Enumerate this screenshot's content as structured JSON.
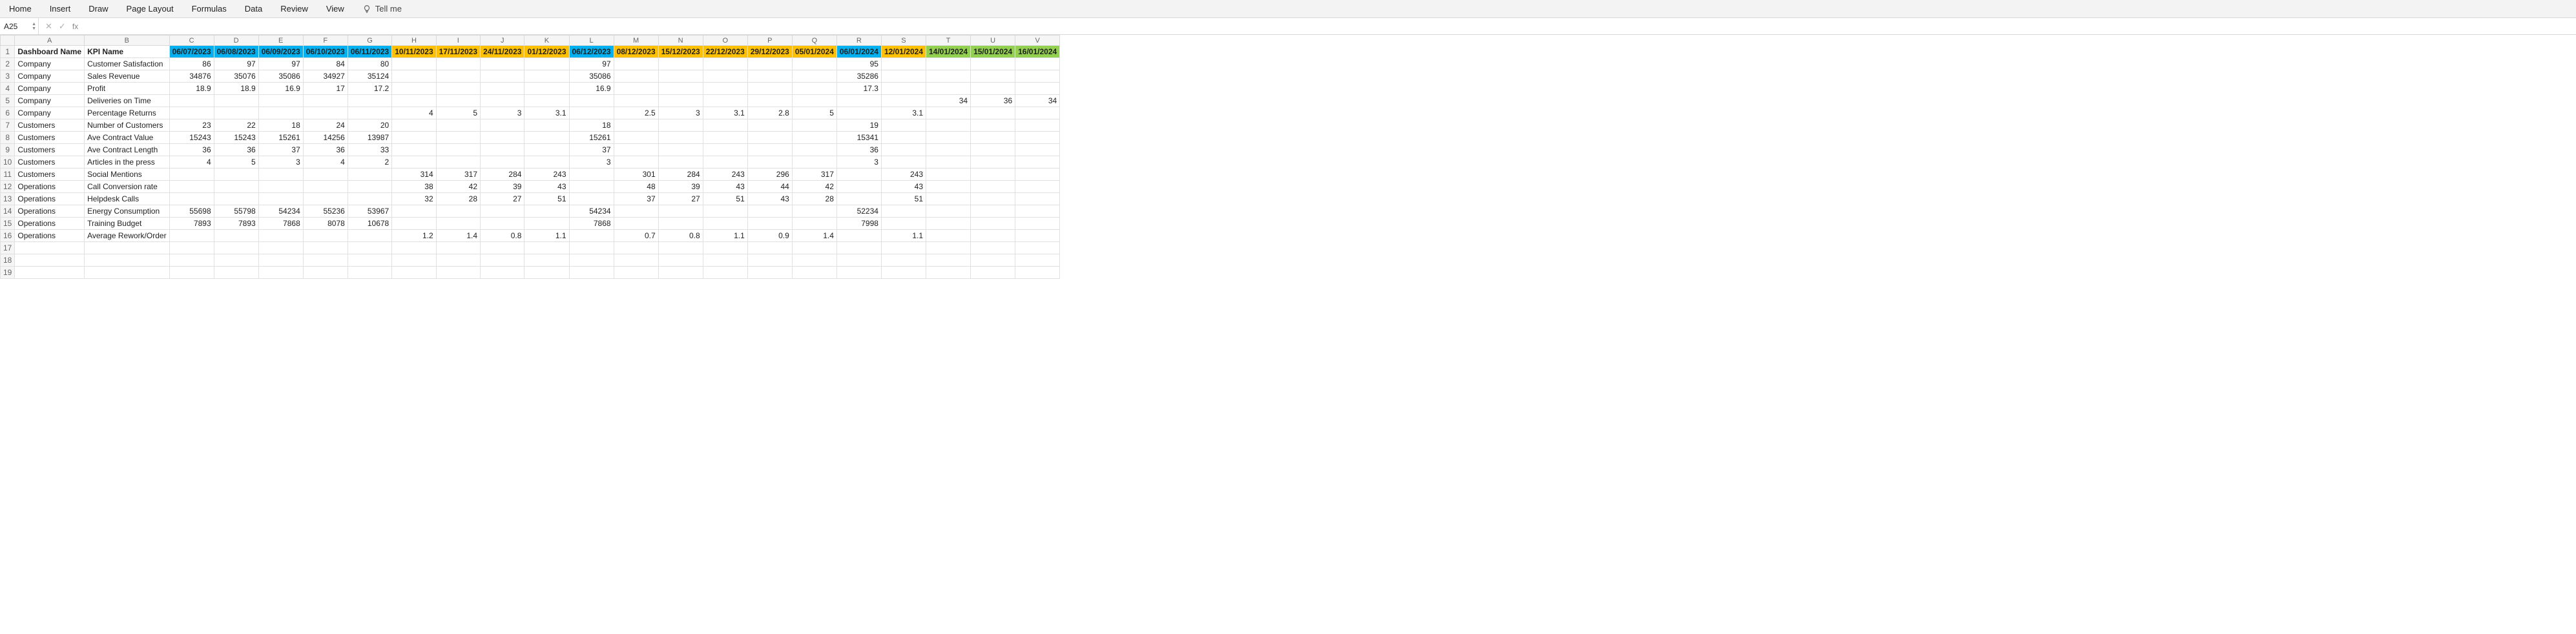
{
  "ribbon": {
    "tabs": [
      "Home",
      "Insert",
      "Draw",
      "Page Layout",
      "Formulas",
      "Data",
      "Review",
      "View"
    ],
    "tellme": "Tell me"
  },
  "fx": {
    "namebox": "A25",
    "cancel_glyph": "✕",
    "confirm_glyph": "✓",
    "fx_label": "fx",
    "formula": ""
  },
  "col_letters": [
    "A",
    "B",
    "C",
    "D",
    "E",
    "F",
    "G",
    "H",
    "I",
    "J",
    "K",
    "L",
    "M",
    "N",
    "O",
    "P",
    "Q",
    "R",
    "S",
    "T",
    "U",
    "V"
  ],
  "headers": {
    "A": "Dashboard Name",
    "B": "KPI Name",
    "dates": [
      {
        "label": "06/07/2023",
        "cls": "c-blue"
      },
      {
        "label": "06/08/2023",
        "cls": "c-blue"
      },
      {
        "label": "06/09/2023",
        "cls": "c-blue"
      },
      {
        "label": "06/10/2023",
        "cls": "c-blue"
      },
      {
        "label": "06/11/2023",
        "cls": "c-blue"
      },
      {
        "label": "10/11/2023",
        "cls": "c-orange"
      },
      {
        "label": "17/11/2023",
        "cls": "c-orange"
      },
      {
        "label": "24/11/2023",
        "cls": "c-orange"
      },
      {
        "label": "01/12/2023",
        "cls": "c-orange"
      },
      {
        "label": "06/12/2023",
        "cls": "c-blue"
      },
      {
        "label": "08/12/2023",
        "cls": "c-orange"
      },
      {
        "label": "15/12/2023",
        "cls": "c-orange"
      },
      {
        "label": "22/12/2023",
        "cls": "c-orange"
      },
      {
        "label": "29/12/2023",
        "cls": "c-orange"
      },
      {
        "label": "05/01/2024",
        "cls": "c-orange"
      },
      {
        "label": "06/01/2024",
        "cls": "c-blue"
      },
      {
        "label": "12/01/2024",
        "cls": "c-orange"
      },
      {
        "label": "14/01/2024",
        "cls": "c-green"
      },
      {
        "label": "15/01/2024",
        "cls": "c-green"
      },
      {
        "label": "16/01/2024",
        "cls": "c-green"
      }
    ]
  },
  "rows": [
    {
      "dash": "Company",
      "kpi": "Customer Satisfaction",
      "v": [
        "86",
        "97",
        "97",
        "84",
        "80",
        "",
        "",
        "",
        "",
        "97",
        "",
        "",
        "",
        "",
        "",
        "95",
        "",
        "",
        "",
        ""
      ]
    },
    {
      "dash": "Company",
      "kpi": "Sales Revenue",
      "v": [
        "34876",
        "35076",
        "35086",
        "34927",
        "35124",
        "",
        "",
        "",
        "",
        "35086",
        "",
        "",
        "",
        "",
        "",
        "35286",
        "",
        "",
        "",
        ""
      ]
    },
    {
      "dash": "Company",
      "kpi": "Profit",
      "v": [
        "18.9",
        "18.9",
        "16.9",
        "17",
        "17.2",
        "",
        "",
        "",
        "",
        "16.9",
        "",
        "",
        "",
        "",
        "",
        "17.3",
        "",
        "",
        "",
        ""
      ]
    },
    {
      "dash": "Company",
      "kpi": "Deliveries on Time",
      "v": [
        "",
        "",
        "",
        "",
        "",
        "",
        "",
        "",
        "",
        "",
        "",
        "",
        "",
        "",
        "",
        "",
        "",
        "34",
        "36",
        "34"
      ]
    },
    {
      "dash": "Company",
      "kpi": "Percentage Returns",
      "v": [
        "",
        "",
        "",
        "",
        "",
        "4",
        "5",
        "3",
        "3.1",
        "",
        "2.5",
        "3",
        "3.1",
        "2.8",
        "5",
        "",
        "3.1",
        "",
        "",
        ""
      ]
    },
    {
      "dash": "Customers",
      "kpi": "Number of Customers",
      "v": [
        "23",
        "22",
        "18",
        "24",
        "20",
        "",
        "",
        "",
        "",
        "18",
        "",
        "",
        "",
        "",
        "",
        "19",
        "",
        "",
        "",
        ""
      ]
    },
    {
      "dash": "Customers",
      "kpi": "Ave Contract Value",
      "v": [
        "15243",
        "15243",
        "15261",
        "14256",
        "13987",
        "",
        "",
        "",
        "",
        "15261",
        "",
        "",
        "",
        "",
        "",
        "15341",
        "",
        "",
        "",
        ""
      ]
    },
    {
      "dash": "Customers",
      "kpi": "Ave Contract Length",
      "v": [
        "36",
        "36",
        "37",
        "36",
        "33",
        "",
        "",
        "",
        "",
        "37",
        "",
        "",
        "",
        "",
        "",
        "36",
        "",
        "",
        "",
        ""
      ]
    },
    {
      "dash": "Customers",
      "kpi": "Articles in the press",
      "v": [
        "4",
        "5",
        "3",
        "4",
        "2",
        "",
        "",
        "",
        "",
        "3",
        "",
        "",
        "",
        "",
        "",
        "3",
        "",
        "",
        "",
        ""
      ]
    },
    {
      "dash": "Customers",
      "kpi": "Social Mentions",
      "v": [
        "",
        "",
        "",
        "",
        "",
        "314",
        "317",
        "284",
        "243",
        "",
        "301",
        "284",
        "243",
        "296",
        "317",
        "",
        "243",
        "",
        "",
        ""
      ]
    },
    {
      "dash": "Operations",
      "kpi": "Call Conversion rate",
      "v": [
        "",
        "",
        "",
        "",
        "",
        "38",
        "42",
        "39",
        "43",
        "",
        "48",
        "39",
        "43",
        "44",
        "42",
        "",
        "43",
        "",
        "",
        ""
      ]
    },
    {
      "dash": "Operations",
      "kpi": "Helpdesk Calls",
      "v": [
        "",
        "",
        "",
        "",
        "",
        "32",
        "28",
        "27",
        "51",
        "",
        "37",
        "27",
        "51",
        "43",
        "28",
        "",
        "51",
        "",
        "",
        ""
      ]
    },
    {
      "dash": "Operations",
      "kpi": "Energy Consumption",
      "v": [
        "55698",
        "55798",
        "54234",
        "55236",
        "53967",
        "",
        "",
        "",
        "",
        "54234",
        "",
        "",
        "",
        "",
        "",
        "52234",
        "",
        "",
        "",
        ""
      ]
    },
    {
      "dash": "Operations",
      "kpi": "Training Budget",
      "v": [
        "7893",
        "7893",
        "7868",
        "8078",
        "10678",
        "",
        "",
        "",
        "",
        "7868",
        "",
        "",
        "",
        "",
        "",
        "7998",
        "",
        "",
        "",
        ""
      ]
    },
    {
      "dash": "Operations",
      "kpi": "Average Rework/Order",
      "v": [
        "",
        "",
        "",
        "",
        "",
        "1.2",
        "1.4",
        "0.8",
        "1.1",
        "",
        "0.7",
        "0.8",
        "1.1",
        "0.9",
        "1.4",
        "",
        "1.1",
        "",
        "",
        ""
      ]
    }
  ],
  "empty_rows": 3
}
